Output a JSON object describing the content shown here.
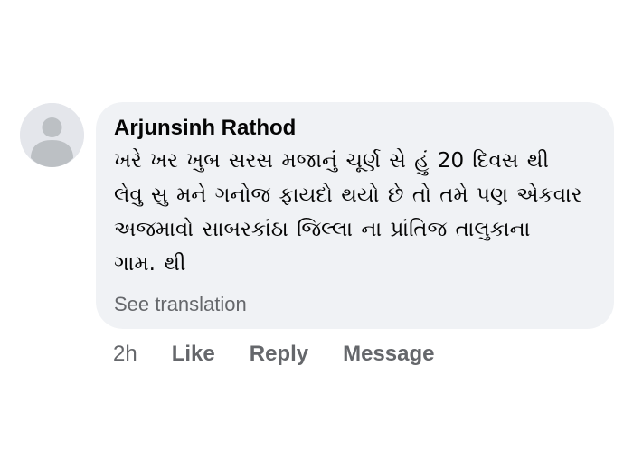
{
  "comment": {
    "author": "Arjunsinh Rathod",
    "avatar_icon": "default-profile-silhouette-icon",
    "text_lines": [
      "ખરે ખર ખુબ સરસ મજાનું  ચૂર્ણ સે હું 20 દિવસ થી",
      "લેવુ સુ  મને ગનોજ ફાયદો થયો છે તો તમે પણ એકવાર",
      "અજમાવો સાબરકાંઠા જિલ્લા ના પ્રાંતિજ તાલુકાના",
      "ગામ. થી"
    ],
    "see_translation_label": "See translation",
    "timestamp": "2h",
    "actions": {
      "like_label": "Like",
      "reply_label": "Reply",
      "message_label": "Message"
    }
  },
  "colors": {
    "bubble_background": "#f0f2f5",
    "primary_text": "#050505",
    "secondary_text": "#65676b",
    "avatar_background": "#e4e6eb",
    "avatar_silhouette": "#bcc0c4"
  }
}
